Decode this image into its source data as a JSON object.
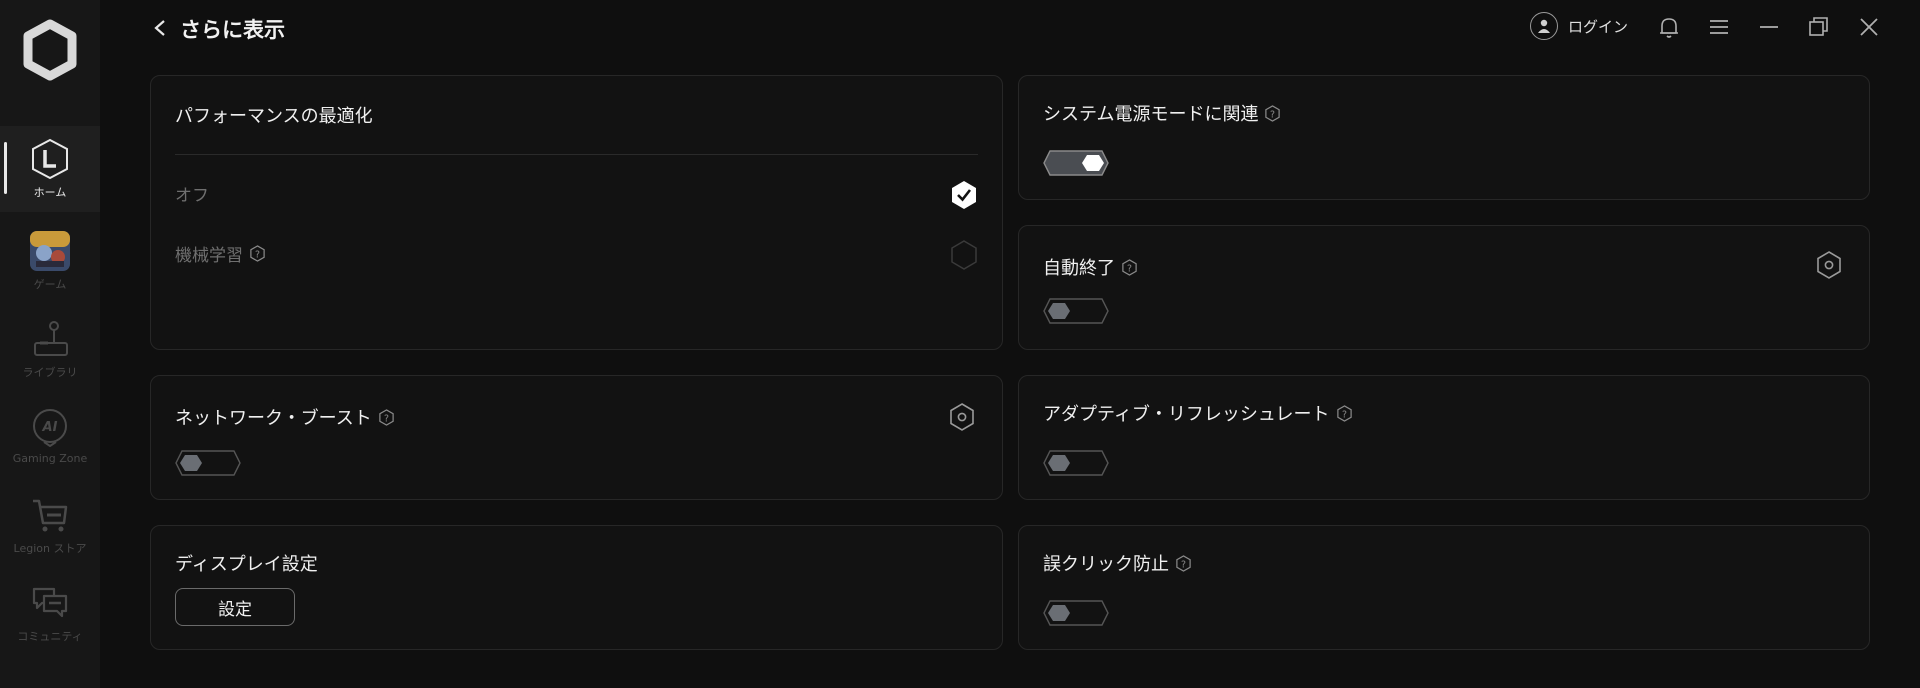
{
  "sidebar": {
    "items": [
      {
        "label": "ホーム",
        "icon": "legion-home-icon"
      },
      {
        "label": "ゲーム",
        "icon": "game-thumbnail"
      },
      {
        "label": "ライブラリ",
        "icon": "joystick-icon"
      },
      {
        "label": "Gaming Zone",
        "icon": "ai-icon"
      },
      {
        "label": "Legion ストア",
        "icon": "cart-icon"
      },
      {
        "label": "コミュニティ",
        "icon": "chat-icon"
      }
    ]
  },
  "header": {
    "title": "さらに表示",
    "login_label": "ログイン"
  },
  "cards": {
    "performance": {
      "title": "パフォーマンスの最適化",
      "options": [
        {
          "label": "オフ",
          "selected": true
        },
        {
          "label": "機械学習",
          "selected": false
        }
      ]
    },
    "system_power": {
      "title": "システム電源モードに関連",
      "enabled": true
    },
    "auto_close": {
      "title": "自動終了",
      "enabled": false
    },
    "network_boost": {
      "title": "ネットワーク・ブースト",
      "enabled": false
    },
    "adaptive_refresh": {
      "title": "アダプティブ・リフレッシュレート",
      "enabled": false
    },
    "display": {
      "title": "ディスプレイ設定",
      "button_label": "設定"
    },
    "misclick": {
      "title": "誤クリック防止",
      "enabled": false
    }
  },
  "colors": {
    "background": "#0f0f0f",
    "card": "#121212",
    "accent": "#ffffff",
    "toggle_off": "#6a6e74"
  }
}
